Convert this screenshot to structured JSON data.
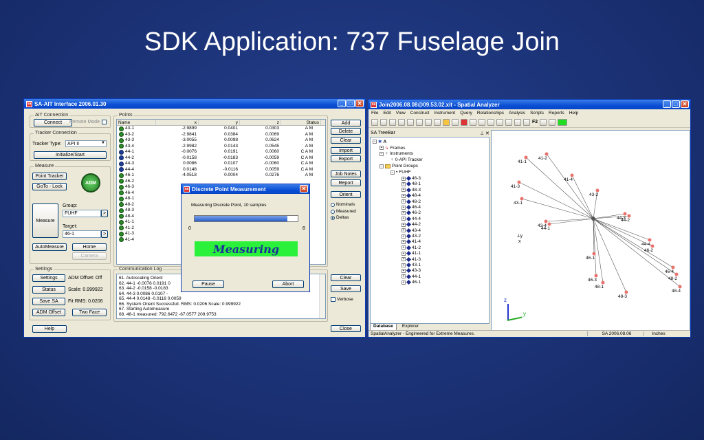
{
  "slide": {
    "title": "SDK Application: 737 Fuselage Join"
  },
  "ait": {
    "title": "SA-AIT Interface 2006.01.30",
    "connection": {
      "label": "AIT Connection",
      "connect": "Connect",
      "remote_mode": "Remote Mode"
    },
    "tracker": {
      "label": "Tracker Connection",
      "type_label": "Tracker Type:",
      "type_value": "API II",
      "init": "Initialize/Start"
    },
    "measure": {
      "label": "Measure",
      "point_tracker": "Point Tracker",
      "goto_lock": "GoTo - Lock",
      "adm": "ADM",
      "measure": "Measure",
      "group_label": "Group:",
      "group_value": "FUHF",
      "target_label": "Target:",
      "target_value": "46-1",
      "auto_measure": "AutoMeasure",
      "home": "Home",
      "camera": "Camera"
    },
    "settings": {
      "label": "Settings",
      "settings_btn": "Settings",
      "adm_offset": "ADM Offset: Off",
      "status_btn": "Status",
      "scale": "Scale:  0.999922",
      "save_sa": "Save SA",
      "fit_rms": "Fit RMS:  0.0206",
      "adm_offset_btn": "ADM Offset",
      "two_face": "Two Face"
    },
    "help": "Help",
    "close": "Close",
    "points": {
      "label": "Points",
      "columns": [
        "Name",
        "x",
        "y",
        "z",
        "Status"
      ],
      "rows": [
        {
          "name": "43-1",
          "x": "-2.9899",
          "y": "0.0401",
          "z": "0.0303",
          "status": "A M",
          "icon": "green"
        },
        {
          "name": "43-2",
          "x": "-2.9841",
          "y": "0.0384",
          "z": "0.0069",
          "status": "A M",
          "icon": "green"
        },
        {
          "name": "43-3",
          "x": "-3.0055",
          "y": "0.0098",
          "z": "0.0624",
          "status": "A M",
          "icon": "green"
        },
        {
          "name": "43-4",
          "x": "-2.9982",
          "y": "0.0143",
          "z": "0.0545",
          "status": "A M",
          "icon": "green"
        },
        {
          "name": "44-1",
          "x": "-0.0076",
          "y": "0.0191",
          "z": "0.0060",
          "status": "C A M",
          "icon": "blue"
        },
        {
          "name": "44-2",
          "x": "-0.0158",
          "y": "-0.0183",
          "z": "-0.0059",
          "status": "C A M",
          "icon": "blue"
        },
        {
          "name": "44-3",
          "x": "0.0086",
          "y": "0.0107",
          "z": "-0.0060",
          "status": "C A M",
          "icon": "blue"
        },
        {
          "name": "44-4",
          "x": "0.0148",
          "y": "-0.0116",
          "z": "0.0059",
          "status": "C A M",
          "icon": "blue"
        },
        {
          "name": "46-1",
          "x": "-4.0518",
          "y": "0.0004",
          "z": "0.0276",
          "status": "A M",
          "icon": "green"
        },
        {
          "name": "46-2",
          "x": "",
          "y": "",
          "z": "",
          "status": "",
          "icon": "green"
        },
        {
          "name": "46-3",
          "x": "",
          "y": "",
          "z": "",
          "status": "",
          "icon": "green"
        },
        {
          "name": "46-4",
          "x": "",
          "y": "",
          "z": "",
          "status": "",
          "icon": "green"
        },
        {
          "name": "48-1",
          "x": "",
          "y": "",
          "z": "",
          "status": "",
          "icon": "green"
        },
        {
          "name": "48-2",
          "x": "",
          "y": "",
          "z": "",
          "status": "",
          "icon": "green"
        },
        {
          "name": "48-3",
          "x": "",
          "y": "",
          "z": "",
          "status": "",
          "icon": "green"
        },
        {
          "name": "48-4",
          "x": "",
          "y": "",
          "z": "",
          "status": "",
          "icon": "green"
        },
        {
          "name": "41-1",
          "x": "",
          "y": "",
          "z": "",
          "status": "",
          "icon": "green"
        },
        {
          "name": "41-2",
          "x": "",
          "y": "",
          "z": "",
          "status": "",
          "icon": "green"
        },
        {
          "name": "41-3",
          "x": "",
          "y": "",
          "z": "",
          "status": "",
          "icon": "green"
        },
        {
          "name": "41-4",
          "x": "",
          "y": "",
          "z": "",
          "status": "",
          "icon": "green"
        }
      ]
    },
    "side_buttons": {
      "add": "Add",
      "delete": "Delete",
      "clear": "Clear",
      "import": "Import",
      "export": "Export",
      "job_notes": "Job Notes",
      "report": "Report",
      "orient": "Orient",
      "nominals": "Nominals",
      "measured": "Measured",
      "deltas": "Deltas"
    },
    "log": {
      "label": "Communication Log",
      "lines": [
        "61. Autoscaling Orient",
        "62. 44-1 -0.0076 0.0191 0",
        "63. 44-2 -0.0158 -0.0183",
        "64. 44-3 0.0086 0.0107 -",
        "65. 44-4 0.0148 -0.0116 0.0059",
        "66. System Orient Successfull. RMS: 0.0206  Scale: 0.999922",
        "67. Starting Automeasure",
        "68. 46-1 measured: 792.6472 -67.0577 209.9753"
      ],
      "clear": "Clear",
      "save": "Save",
      "verbose": "Verbose"
    }
  },
  "dialog": {
    "title": "Discrete Point Measurement",
    "message": "Measuring  Discrete Point, 10 samples",
    "progress": 0.9,
    "min_label": "0",
    "max_label": "8",
    "status": "Measuring",
    "pause": "Pause",
    "abort": "Abort"
  },
  "sa": {
    "title": "Join2006.08.08@09.53.02.xit - Spatial Analyzer",
    "menu": [
      "File",
      "Edit",
      "View",
      "Construct",
      "Instrument",
      "Query",
      "Relationships",
      "Analysis",
      "Scripts",
      "Reports",
      "Help"
    ],
    "treebar_title": "SA TreeBar",
    "tree": {
      "root": "A",
      "frames": "Frames",
      "instruments": "Instruments",
      "tracker": "0-API Tracker",
      "point_groups": "Point Groups",
      "group": "FUHF",
      "points": [
        "46-3",
        "48-1",
        "48-3",
        "48-4",
        "48-2",
        "46-4",
        "46-2",
        "44-4",
        "44-2",
        "43-4",
        "43-2",
        "41-4",
        "41-2",
        "41-1",
        "41-3",
        "43-1",
        "43-3",
        "44-1",
        "46-1"
      ]
    },
    "tabs": {
      "database": "Database",
      "explorer": "Explorer"
    },
    "status": {
      "left": "SpatialAnalyzer - Engineered for Extreme Measures.",
      "version": "SA 2006.08.06",
      "units": "Inches"
    },
    "f2": "F2",
    "axes": {
      "z": "z",
      "y": "y",
      "x": "x"
    }
  },
  "graph": {
    "labels": [
      "41-1",
      "41-2",
      "41-4",
      "41-3",
      "43-2",
      "43-1",
      "43-4",
      "44-1",
      "44-3",
      "44-2",
      "44-4",
      "46-2",
      "46-1",
      "46-3",
      "48-1",
      "46-4",
      "48-2",
      "48-4",
      "48-3"
    ],
    "node_color": "#e8726b",
    "line_color": "#555555"
  }
}
